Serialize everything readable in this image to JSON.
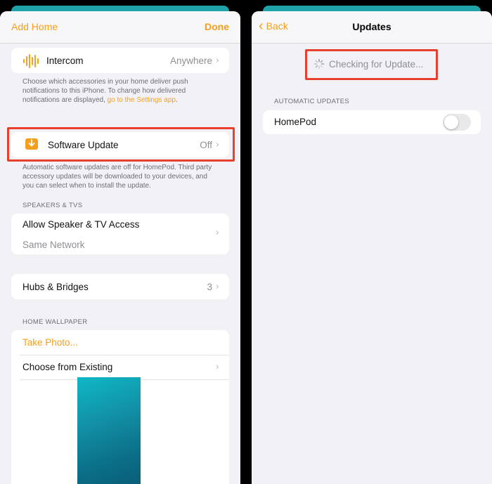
{
  "left": {
    "nav": {
      "left_label": "Add Home",
      "right_label": "Done"
    },
    "intercom": {
      "label": "Intercom",
      "value": "Anywhere",
      "icon": "waveform-icon"
    },
    "intercom_note": {
      "text": "Choose which accessories in your home deliver push notifications to this iPhone. To change how delivered notifications are displayed, ",
      "link": "go to the Settings app",
      "end": "."
    },
    "software_update": {
      "label": "Software Update",
      "value": "Off",
      "icon": "download-icon"
    },
    "software_note": "Automatic software updates are off for HomePod. Third party accessory updates will be downloaded to your devices, and you can select when to install the update.",
    "speakers_header": "SPEAKERS & TVS",
    "speaker_access": {
      "label": "Allow Speaker & TV Access",
      "value": "Same Network"
    },
    "hubs": {
      "label": "Hubs & Bridges",
      "value": "3"
    },
    "wallpaper_header": "HOME WALLPAPER",
    "take_photo": "Take Photo...",
    "choose_existing": "Choose from Existing"
  },
  "right": {
    "nav": {
      "back_label": "Back",
      "title": "Updates"
    },
    "checking": "Checking for Update...",
    "auto_header": "AUTOMATIC UPDATES",
    "homepod": {
      "label": "HomePod",
      "toggle_on": false
    }
  },
  "colors": {
    "accent": "#f4a01c",
    "highlight": "#e8402d",
    "teal": "#1fa3a8"
  }
}
